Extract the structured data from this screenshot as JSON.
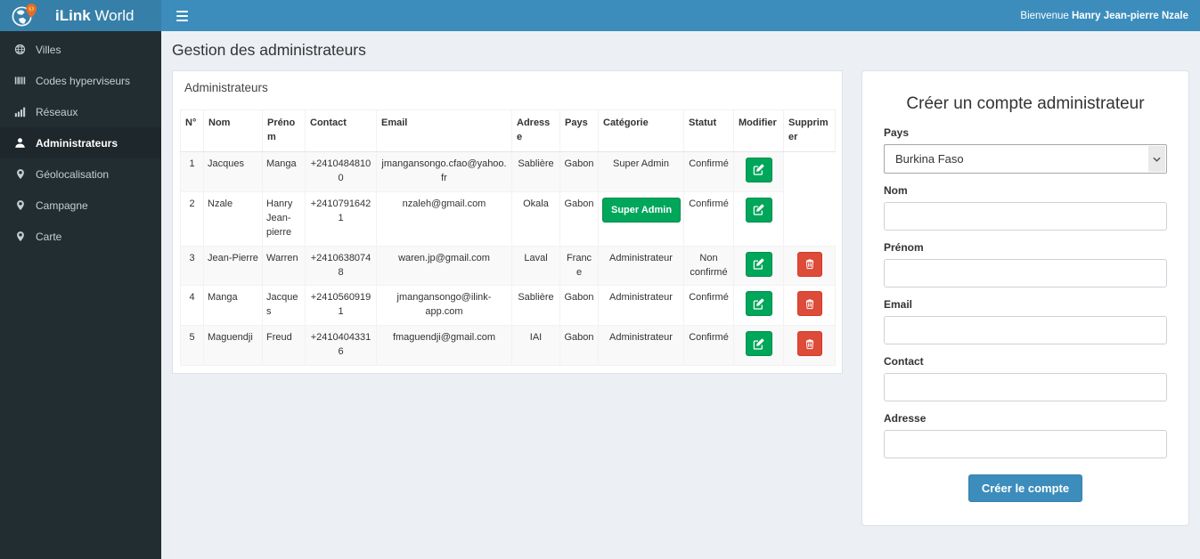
{
  "brand": {
    "name_bold": "iLink",
    "name_rest": "World",
    "logo_icon": "globe-pin-icon"
  },
  "topbar": {
    "menu_icon": "hamburger-icon",
    "welcome_prefix": "Bienvenue ",
    "user_name": "Hanry Jean-pierre Nzale"
  },
  "sidebar": {
    "items": [
      {
        "id": "villes",
        "label": "Villes",
        "icon": "globe-icon",
        "active": false
      },
      {
        "id": "codes-hyperviseurs",
        "label": "Codes hyperviseurs",
        "icon": "barcode-icon",
        "active": false
      },
      {
        "id": "reseaux",
        "label": "Réseaux",
        "icon": "signal-icon",
        "active": false
      },
      {
        "id": "administrateurs",
        "label": "Administrateurs",
        "icon": "user-icon",
        "active": true
      },
      {
        "id": "geolocalisation",
        "label": "Géolocalisation",
        "icon": "map-marker-icon",
        "active": false
      },
      {
        "id": "campagne",
        "label": "Campagne",
        "icon": "map-marker-icon",
        "active": false
      },
      {
        "id": "carte",
        "label": "Carte",
        "icon": "map-marker-icon",
        "active": false
      }
    ]
  },
  "page": {
    "title": "Gestion des administrateurs"
  },
  "admin_panel": {
    "title": "Administrateurs",
    "edit_icon": "edit-icon",
    "delete_icon": "trash-icon",
    "columns": [
      "N°",
      "Nom",
      "Prénom",
      "Contact",
      "Email",
      "Adresse",
      "Pays",
      "Catégorie",
      "Statut",
      "Modifier",
      "Supprimer"
    ],
    "rows": [
      {
        "num": "1",
        "nom": "Jacques",
        "prenom": "Manga",
        "contact": "+24104848100",
        "email": "jmangansongo.cfao@yahoo.fr",
        "adresse": "Sablière",
        "pays": "Gabon",
        "categorie": "Super Admin",
        "categorie_as_button": false,
        "statut": "Confirmé",
        "has_delete": false
      },
      {
        "num": "2",
        "nom": "Nzale",
        "prenom": "Hanry Jean-pierre",
        "contact": "+24107916421",
        "email": "nzaleh@gmail.com",
        "adresse": "Okala",
        "pays": "Gabon",
        "categorie": "Super Admin",
        "categorie_as_button": true,
        "statut": "Confirmé",
        "has_delete": false
      },
      {
        "num": "3",
        "nom": "Jean-Pierre",
        "prenom": "Warren",
        "contact": "+24106380748",
        "email": "waren.jp@gmail.com",
        "adresse": "Laval",
        "pays": "France",
        "categorie": "Administrateur",
        "categorie_as_button": false,
        "statut": "Non confirmé",
        "has_delete": true
      },
      {
        "num": "4",
        "nom": "Manga",
        "prenom": "Jacques",
        "contact": "+24105609191",
        "email": "jmangansongo@ilink-app.com",
        "adresse": "Sablière",
        "pays": "Gabon",
        "categorie": "Administrateur",
        "categorie_as_button": false,
        "statut": "Confirmé",
        "has_delete": true
      },
      {
        "num": "5",
        "nom": "Maguendji",
        "prenom": "Freud",
        "contact": "+24104043316",
        "email": "fmaguendji@gmail.com",
        "adresse": "IAI",
        "pays": "Gabon",
        "categorie": "Administrateur",
        "categorie_as_button": false,
        "statut": "Confirmé",
        "has_delete": true
      }
    ]
  },
  "create_form": {
    "title": "Créer un compte administrateur",
    "fields": [
      {
        "name": "pays",
        "label": "Pays",
        "type": "select",
        "value": "Burkina Faso",
        "icon": "chevron-down-icon"
      },
      {
        "name": "nom",
        "label": "Nom",
        "type": "text",
        "value": ""
      },
      {
        "name": "prenom",
        "label": "Prénom",
        "type": "text",
        "value": ""
      },
      {
        "name": "email",
        "label": "Email",
        "type": "text",
        "value": ""
      },
      {
        "name": "contact",
        "label": "Contact",
        "type": "text",
        "value": ""
      },
      {
        "name": "adresse",
        "label": "Adresse",
        "type": "text",
        "value": ""
      }
    ],
    "submit_label": "Créer le compte"
  },
  "colors": {
    "navbar": "#3c8dbc",
    "logo_bg": "#367fa9",
    "sidebar": "#222d32",
    "sidebar_active": "#1e282c",
    "success": "#00a65a",
    "danger": "#dd4b39",
    "primary": "#3c8dbc",
    "page_bg": "#ecf0f5"
  }
}
